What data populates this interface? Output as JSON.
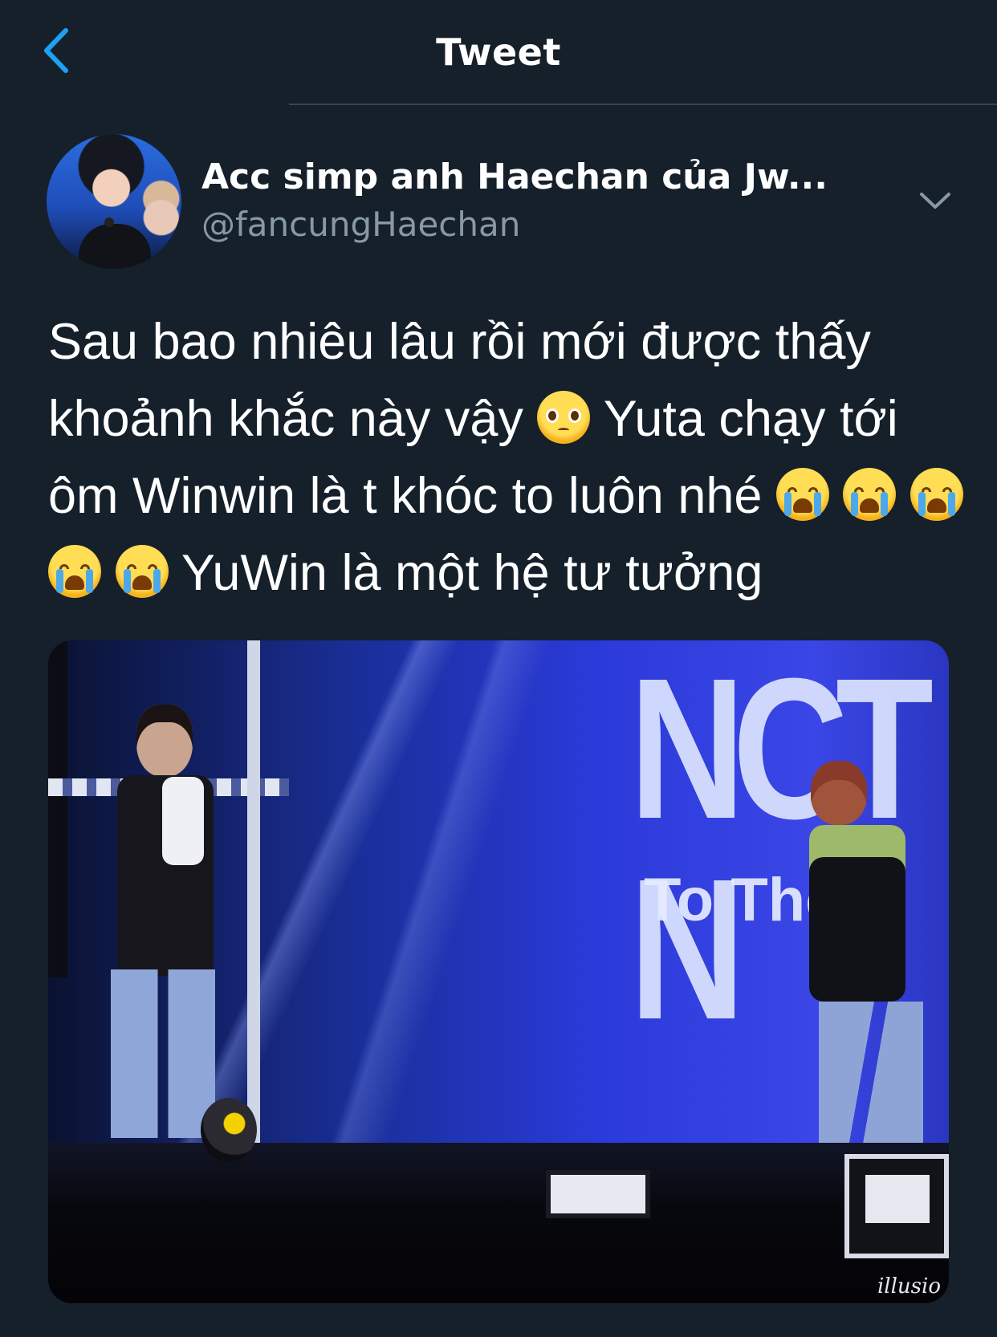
{
  "header": {
    "title": "Tweet",
    "back_icon": "chevron-left-icon"
  },
  "author": {
    "display_name": "Acc simp anh Haechan của Jw...",
    "handle": "@fancungHaechan",
    "more_icon": "chevron-down-icon"
  },
  "tweet": {
    "text_part1": "Sau bao nhiêu lâu rồi mới được thấy khoảnh khắc này vậy",
    "emoji1": "pleading-face-emoji",
    "text_part2": "Yuta chạy tới ôm Winwin là t khóc to luôn nhé",
    "emoji_crying_count": 5,
    "emoji_crying": "loudly-crying-face-emoji",
    "text_part3": "YuWin là một hệ tư tưởng"
  },
  "media": {
    "screen_logo": "NCT N",
    "screen_sub": "To The",
    "watermark": "illusio"
  },
  "colors": {
    "background": "#15202b",
    "text_primary": "#ffffff",
    "text_secondary": "#8899a6",
    "accent": "#1da1f2",
    "divider": "#38444d"
  }
}
